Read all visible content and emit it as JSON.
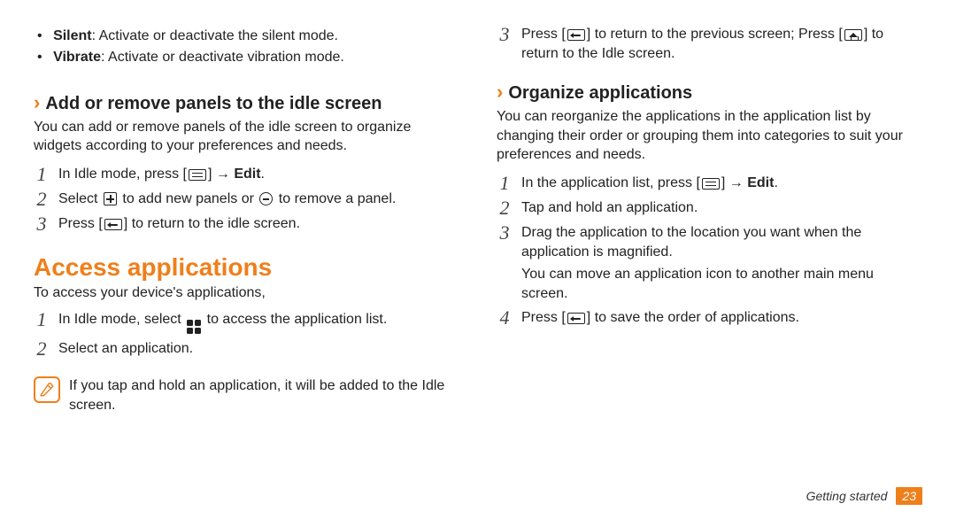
{
  "bullets": [
    {
      "term": "Silent",
      "desc": ": Activate or deactivate the silent mode."
    },
    {
      "term": "Vibrate",
      "desc": ": Activate or deactivate vibration mode."
    }
  ],
  "sec_add": {
    "title": "Add or remove panels to the idle screen",
    "intro": "You can add or remove panels of the idle screen to organize widgets according to your preferences and needs.",
    "steps": [
      {
        "n": "1",
        "pre": "In Idle mode, press [",
        "post": "] → ",
        "bold": "Edit",
        "tail": "."
      },
      {
        "n": "2",
        "pre": "Select ",
        "mid": " to add new panels or ",
        "post": " to remove a panel."
      },
      {
        "n": "3",
        "pre": "Press [",
        "post": "] to return to the idle screen."
      }
    ]
  },
  "sec_access": {
    "title": "Access applications",
    "intro": "To access your device's applications,",
    "steps": [
      {
        "n": "1",
        "pre": "In Idle mode, select ",
        "post": " to access the application list."
      },
      {
        "n": "2",
        "body": "Select an application."
      }
    ],
    "note": "If you tap and hold an application, it will be added to the Idle screen."
  },
  "right_top_step": {
    "n": "3",
    "pre": "Press [",
    "mid": "] to return to the previous screen; Press [",
    "post": "] to return to the Idle screen."
  },
  "sec_org": {
    "title": "Organize applications",
    "intro": "You can reorganize the applications in the application list by changing their order or grouping them into categories to suit your preferences and needs.",
    "steps": [
      {
        "n": "1",
        "pre": "In the application list, press [",
        "post": "] → ",
        "bold": "Edit",
        "tail": "."
      },
      {
        "n": "2",
        "body": "Tap and hold an application."
      },
      {
        "n": "3",
        "body": "Drag the application to the location you want when the application is magnified.",
        "sub": "You can move an application icon to another main menu screen."
      },
      {
        "n": "4",
        "pre": "Press [",
        "post": "] to save the order of applications."
      }
    ]
  },
  "footer": {
    "section": "Getting started",
    "page": "23"
  }
}
